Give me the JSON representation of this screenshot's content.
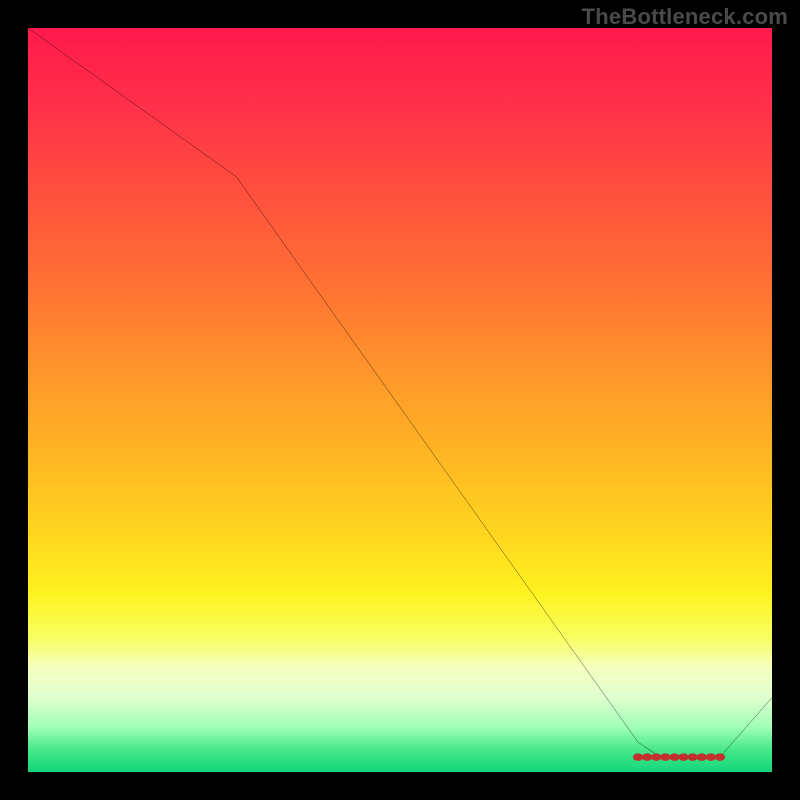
{
  "watermark": "TheBottleneck.com",
  "chart_data": {
    "type": "line",
    "title": "",
    "xlabel": "",
    "ylabel": "",
    "xlim": [
      0,
      100
    ],
    "ylim": [
      0,
      100
    ],
    "x": [
      0,
      28,
      82,
      85,
      90,
      93,
      100
    ],
    "values": [
      100,
      80,
      4,
      2,
      2,
      2,
      10
    ],
    "flat_segment": {
      "start_x": 82,
      "end_x": 93,
      "y": 2,
      "dot_count": 10
    },
    "gradient_stops": [
      {
        "pct": 0,
        "color": "#ff1a4b"
      },
      {
        "pct": 20,
        "color": "#ff4a3f"
      },
      {
        "pct": 44,
        "color": "#ff8f2d"
      },
      {
        "pct": 68,
        "color": "#ffd61f"
      },
      {
        "pct": 86,
        "color": "#f5ffc0"
      },
      {
        "pct": 100,
        "color": "#12d67a"
      }
    ]
  }
}
